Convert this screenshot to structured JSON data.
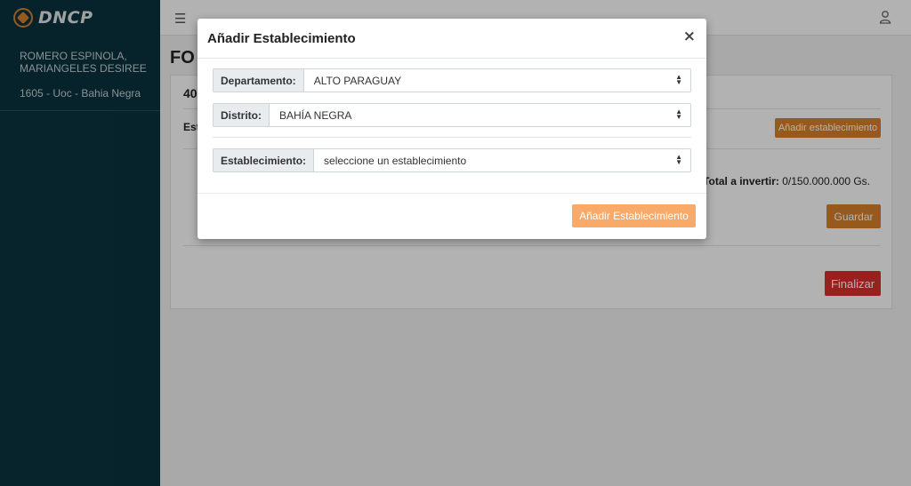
{
  "brand": {
    "logo_text": "DNCP"
  },
  "sidebar": {
    "user_name": "ROMERO ESPINOLA, MARIANGELES DESIREE",
    "unit": "1605 - Uoc - Bahia Negra"
  },
  "header": {
    "menu_icon": "hamburger-icon",
    "user_icon": "user-icon"
  },
  "main": {
    "page_title": "FO",
    "card_number": "40",
    "section_label": "Est",
    "add_establishment_label": "Añadir establecimiento",
    "total_label": "Total a invertir:",
    "total_value": "0/150.000.000 Gs.",
    "save_label": "Guardar",
    "finish_label": "Finalizar"
  },
  "modal": {
    "title": "Añadir Establecimiento",
    "close_glyph": "×",
    "departamento": {
      "label": "Departamento:",
      "value": "ALTO PARAGUAY"
    },
    "distrito": {
      "label": "Distrito:",
      "value": "BAHÍA NEGRA"
    },
    "establecimiento": {
      "label": "Establecimiento:",
      "value": "seleccione un establecimiento"
    },
    "submit_label": "Añadir Establecimiento"
  },
  "colors": {
    "sidebar_bg": "#0a3340",
    "accent_orange": "#d9822b",
    "danger_red": "#d9302b",
    "button_light_orange": "#f9a968"
  }
}
